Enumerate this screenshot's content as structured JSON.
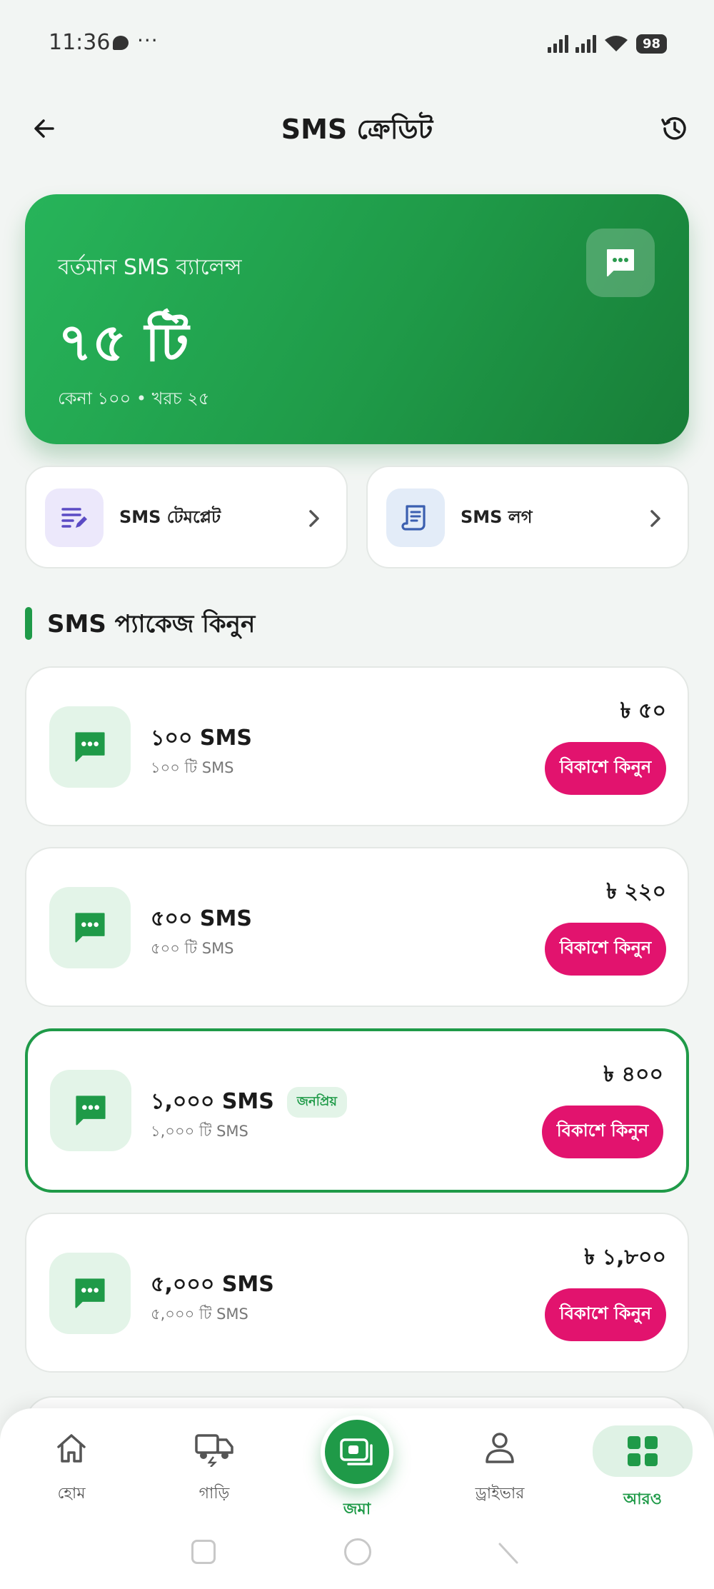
{
  "status_bar": {
    "time": "11:36",
    "more": "···",
    "battery": "98"
  },
  "header": {
    "title": "SMS ক্রেডিট"
  },
  "balance": {
    "label": "বর্তমান SMS ব্যালেন্স",
    "value": "৭৫ টি",
    "sub": "কেনা ১০০ • খরচ ২৫",
    "icon": "chat-bubble-icon"
  },
  "quick_actions": [
    {
      "label": "SMS টেমপ্লেট",
      "icon": "edit-list-icon",
      "color": "#5b4bc4",
      "bg": "#ece8fb"
    },
    {
      "label": "SMS লগ",
      "icon": "receipt-icon",
      "color": "#3b5fb0",
      "bg": "#e3ecf8"
    }
  ],
  "section": {
    "title": "SMS প্যাকেজ কিনুন"
  },
  "packages": [
    {
      "title": "১০০ SMS",
      "sub": "১০০ টি SMS",
      "price": "৳ ৫০",
      "buy": "বিকাশে কিনুন",
      "badge": ""
    },
    {
      "title": "৫০০ SMS",
      "sub": "৫০০ টি SMS",
      "price": "৳ ২২০",
      "buy": "বিকাশে কিনুন",
      "badge": ""
    },
    {
      "title": "১,০০০ SMS",
      "sub": "১,০০০ টি SMS",
      "price": "৳ ৪০০",
      "buy": "বিকাশে কিনুন",
      "badge": "জনপ্রিয়"
    },
    {
      "title": "৫,০০০ SMS",
      "sub": "৫,০০০ টি SMS",
      "price": "৳ ১,৮০০",
      "buy": "বিকাশে কিনুন",
      "badge": ""
    }
  ],
  "bottom_nav": {
    "items": [
      {
        "label": "হোম",
        "icon": "home-icon"
      },
      {
        "label": "গাড়ি",
        "icon": "truck-icon"
      },
      {
        "label": "জমা",
        "icon": "cash-icon"
      },
      {
        "label": "ড্রাইভার",
        "icon": "person-icon"
      },
      {
        "label": "আরও",
        "icon": "grid-icon"
      }
    ]
  },
  "colors": {
    "primary": "#1f9a48",
    "bkash": "#e2136e",
    "background": "#f2f5f3"
  }
}
